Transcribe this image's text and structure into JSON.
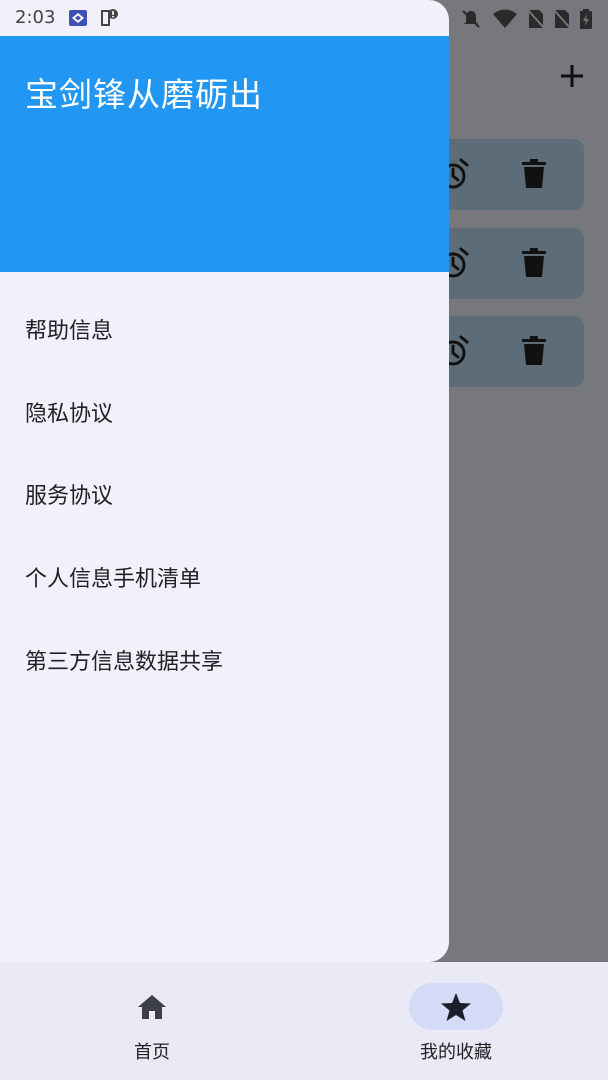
{
  "status_bar": {
    "time": "2:03"
  },
  "drawer": {
    "title": "宝剑锋从磨砺出",
    "header_color": "#2196F3",
    "items": [
      {
        "label": "帮助信息"
      },
      {
        "label": "隐私协议"
      },
      {
        "label": "服务协议"
      },
      {
        "label": "个人信息手机清单"
      },
      {
        "label": "第三方信息数据共享"
      }
    ]
  },
  "background_list": {
    "card_count": 3,
    "card_actions": [
      "alarm-icon",
      "trash-icon"
    ],
    "add_icon": "plus-icon"
  },
  "bottom_nav": {
    "items": [
      {
        "label": "首页",
        "icon": "home-icon",
        "selected": false
      },
      {
        "label": "我的收藏",
        "icon": "star-icon",
        "selected": true
      }
    ]
  }
}
